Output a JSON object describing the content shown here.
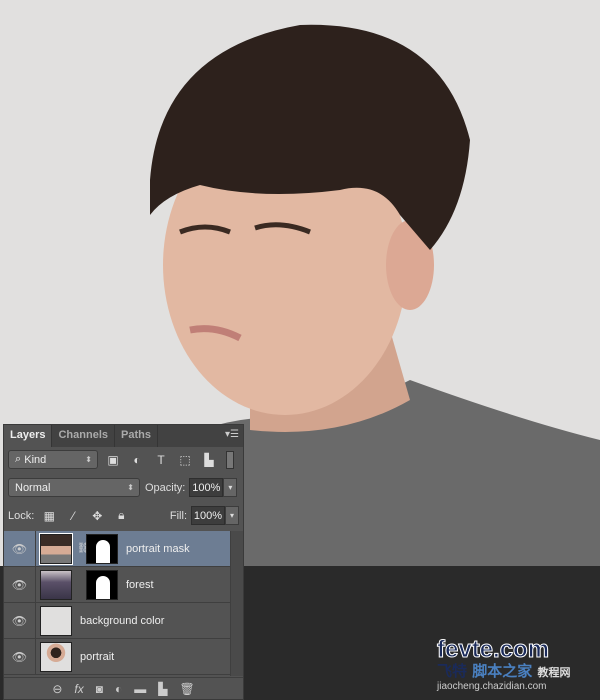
{
  "panel": {
    "tabs": [
      "Layers",
      "Channels",
      "Paths"
    ],
    "active_tab": "Layers",
    "filter": {
      "label": "Kind",
      "icons": [
        "image-filter-icon",
        "adjustment-filter-icon",
        "type-filter-icon",
        "shape-filter-icon",
        "smart-object-filter-icon"
      ],
      "type_glyph": "T"
    },
    "blend_mode": "Normal",
    "opacity_label": "Opacity:",
    "opacity": "100%",
    "lock_label": "Lock:",
    "fill_label": "Fill:",
    "fill": "100%",
    "layers": [
      {
        "name": "portrait mask",
        "selected": true,
        "has_mask": true,
        "visible": true
      },
      {
        "name": "forest",
        "selected": false,
        "has_mask": true,
        "visible": true
      },
      {
        "name": "background color",
        "selected": false,
        "has_mask": false,
        "visible": true
      },
      {
        "name": "portrait",
        "selected": false,
        "has_mask": false,
        "visible": true
      }
    ],
    "footer_icons": [
      "link-icon",
      "fx-icon",
      "mask-icon",
      "adjustment-icon",
      "folder-icon",
      "new-layer-icon",
      "trash-icon"
    ],
    "fx_label": "fx"
  },
  "watermark": {
    "brand": "fevte.com",
    "cn1": "飞特",
    "cn2": "脚本之家",
    "cn3": "教程网",
    "url": "jiaocheng.chazidian.com"
  },
  "colors": {
    "canvas_bg": "#e1e0df",
    "panel": "#535353",
    "selected_layer": "#6d7d93"
  }
}
